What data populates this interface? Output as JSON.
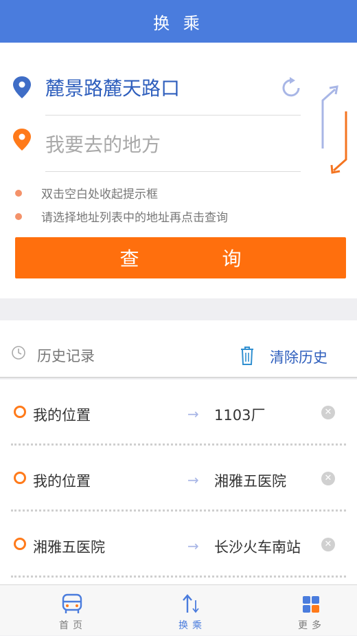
{
  "header": {
    "title": "换 乘"
  },
  "search": {
    "from_value": "麓景路麓天路口",
    "to_placeholder": "我要去的地方",
    "tips": [
      "双击空白处收起提示框",
      "请选择地址列表中的地址再点击查询"
    ],
    "query_button": "查   询"
  },
  "history": {
    "title": "历史记录",
    "clear_label": "清除历史",
    "items": [
      {
        "from": "我的位置",
        "to": "1103厂"
      },
      {
        "from": "我的位置",
        "to": "湘雅五医院"
      },
      {
        "from": "湘雅五医院",
        "to": "长沙火车南站"
      }
    ],
    "arrow": "→"
  },
  "tabbar": {
    "items": [
      {
        "label": "首页"
      },
      {
        "label": "换乘"
      },
      {
        "label": "更多"
      }
    ]
  },
  "colors": {
    "primary": "#4a7cdd",
    "accent": "#ff6f0d",
    "link": "#2f5fbd"
  }
}
